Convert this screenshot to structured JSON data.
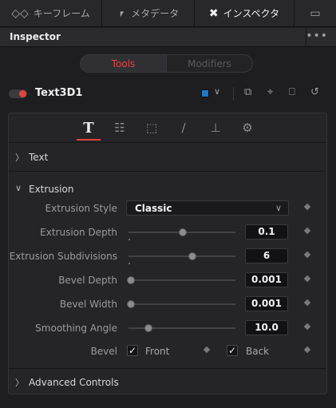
{
  "top_tabs": [
    {
      "icon": "keyframes-icon",
      "label": "キーフレーム"
    },
    {
      "icon": "metadata-icon",
      "label": "メタデータ"
    },
    {
      "icon": "inspector-tools-icon",
      "label": "インスペクタ"
    },
    {
      "icon": "screen-icon",
      "label": ""
    }
  ],
  "header": {
    "title": "Inspector",
    "more": "•••"
  },
  "segmented": {
    "tools": "Tools",
    "modifiers": "Modifiers"
  },
  "node": {
    "name": "Text3D1",
    "color": "#1e78c6"
  },
  "sections": {
    "text": "Text",
    "extrusion": "Extrusion",
    "advanced": "Advanced Controls"
  },
  "params": {
    "extrusion_style": {
      "label": "Extrusion Style",
      "value": "Classic"
    },
    "extrusion_depth": {
      "label": "Extrusion Depth",
      "value": "0.1",
      "level": 0.5
    },
    "extrusion_subdivisions": {
      "label": "Extrusion Subdivisions",
      "value": "6",
      "level": 0.59
    },
    "bevel_depth": {
      "label": "Bevel Depth",
      "value": "0.001",
      "level": 0.0
    },
    "bevel_width": {
      "label": "Bevel Width",
      "value": "0.001",
      "level": 0.0
    },
    "smoothing_angle": {
      "label": "Smoothing Angle",
      "value": "10.0",
      "level": 0.17
    },
    "bevel": {
      "label": "Bevel",
      "front_label": "Front",
      "front_checked": true,
      "back_label": "Back",
      "back_checked": true
    }
  },
  "colors": {
    "accent": "#e2453c",
    "node_color": "#1e78c6"
  }
}
